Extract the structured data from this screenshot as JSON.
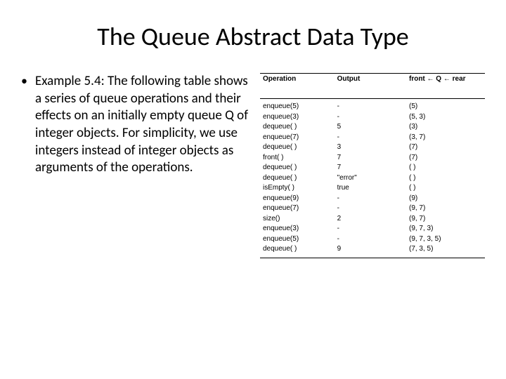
{
  "title": "The Queue Abstract Data Type",
  "bullet_text": "Example 5.4: The following table shows a series of queue operations and their effects on an initially empty queue Q of integer objects. For simplicity, we use integers instead of integer objects as arguments of the operations.",
  "table": {
    "headers": {
      "operation": "Operation",
      "output": "Output",
      "queue": "front ← Q ← rear"
    },
    "rows": [
      {
        "op": "enqueue(5)",
        "out": "-",
        "q": "(5)"
      },
      {
        "op": "enqueue(3)",
        "out": "-",
        "q": "(5, 3)"
      },
      {
        "op": "dequeue( )",
        "out": "5",
        "q": "(3)"
      },
      {
        "op": "enqueue(7)",
        "out": "-",
        "q": "(3, 7)"
      },
      {
        "op": "dequeue( )",
        "out": "3",
        "q": "(7)"
      },
      {
        "op": "front( )",
        "out": "7",
        "q": "(7)"
      },
      {
        "op": "dequeue( )",
        "out": "7",
        "q": "( )"
      },
      {
        "op": "dequeue( )",
        "out": "\"error\"",
        "q": "( )"
      },
      {
        "op": "isEmpty( )",
        "out": "true",
        "q": "( )"
      },
      {
        "op": "enqueue(9)",
        "out": "-",
        "q": "(9)"
      },
      {
        "op": "enqueue(7)",
        "out": "-",
        "q": "(9, 7)"
      },
      {
        "op": "size()",
        "out": "2",
        "q": "(9, 7)"
      },
      {
        "op": "enqueue(3)",
        "out": "-",
        "q": "(9, 7, 3)"
      },
      {
        "op": "enqueue(5)",
        "out": "-",
        "q": "(9, 7, 3, 5)"
      },
      {
        "op": "dequeue( )",
        "out": "9",
        "q": "(7, 3, 5)"
      }
    ]
  }
}
